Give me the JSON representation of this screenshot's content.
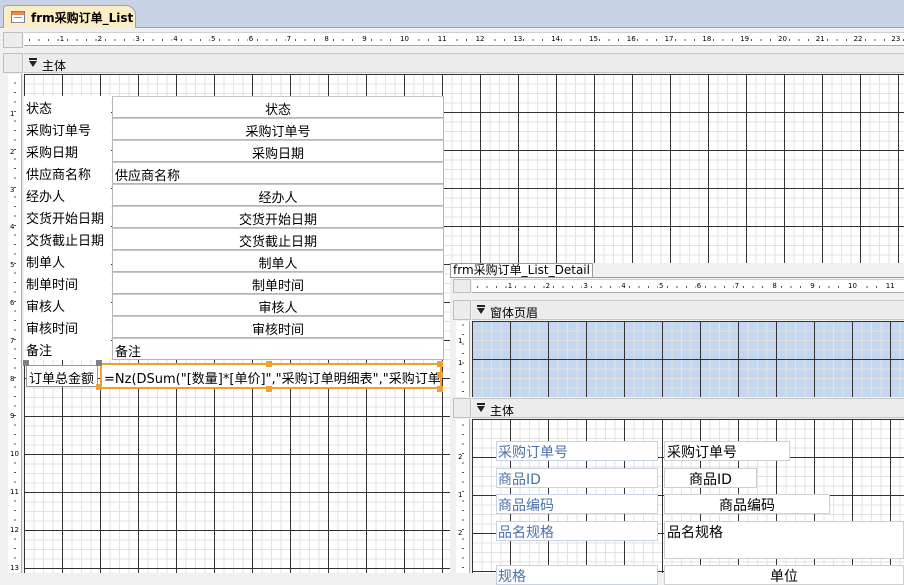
{
  "document_tab": {
    "title": "frm采购订单_List"
  },
  "main_form": {
    "ruler_numbers": [
      "1",
      "2",
      "3",
      "4",
      "5",
      "6",
      "7",
      "8",
      "9",
      "10",
      "11",
      "12",
      "13",
      "14",
      "15",
      "16",
      "17",
      "18",
      "19",
      "20",
      "21",
      "22",
      "23"
    ],
    "vruler_numbers": [
      "1",
      "2",
      "3",
      "4",
      "5",
      "6",
      "7",
      "8",
      "9",
      "10",
      "11",
      "12",
      "13"
    ],
    "section_title": "主体",
    "rows": [
      {
        "label": "状态",
        "value": "状态",
        "align": "center"
      },
      {
        "label": "采购订单号",
        "value": "采购订单号",
        "align": "center"
      },
      {
        "label": "采购日期",
        "value": "采购日期",
        "align": "center"
      },
      {
        "label": "供应商名称",
        "value": "供应商名称",
        "align": "left"
      },
      {
        "label": "经办人",
        "value": "经办人",
        "align": "center"
      },
      {
        "label": "交货开始日期",
        "value": "交货开始日期",
        "align": "center"
      },
      {
        "label": "交货截止日期",
        "value": "交货截止日期",
        "align": "center"
      },
      {
        "label": "制单人",
        "value": "制单人",
        "align": "center"
      },
      {
        "label": "制单时间",
        "value": "制单时间",
        "align": "center"
      },
      {
        "label": "审核人",
        "value": "审核人",
        "align": "center"
      },
      {
        "label": "审核时间",
        "value": "审核时间",
        "align": "center"
      },
      {
        "label": "备注",
        "value": "备注",
        "align": "left"
      }
    ],
    "total": {
      "label": "订单总金额",
      "expression": "=Nz(DSum(\"[数量]*[单价]\",\"采购订单明细表\",\"采购订单号"
    }
  },
  "subform": {
    "title": "frm采购订单_List_Detail",
    "ruler_numbers": [
      "1",
      "2",
      "3",
      "4",
      "5",
      "6",
      "7",
      "8",
      "9",
      "10",
      "11"
    ],
    "vruler_numbers": [
      "1",
      "1",
      "2",
      "1",
      "2"
    ],
    "header_section": "窗体页眉",
    "detail_section": "主体",
    "rows": [
      {
        "label": "采购订单号",
        "value": "采购订单号",
        "align": "left"
      },
      {
        "label": "商品ID",
        "value": "商品ID",
        "align": "center"
      },
      {
        "label": "商品编码",
        "value": "商品编码",
        "align": "center"
      },
      {
        "label": "品名规格",
        "value": "品名规格",
        "align": "left"
      },
      {
        "label": "规格",
        "value": "单位",
        "align": "center"
      }
    ]
  }
}
